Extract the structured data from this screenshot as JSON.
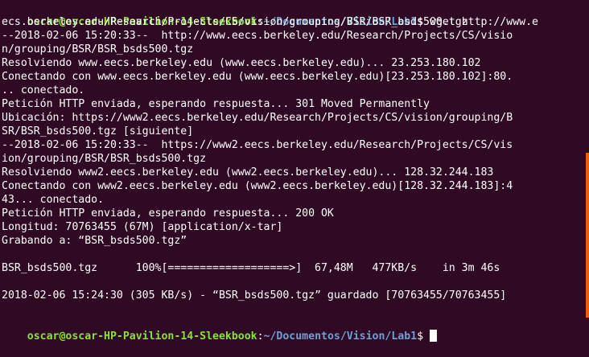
{
  "prompt": {
    "user_host": "oscar@oscar-HP-Pavilion-14-Sleekbook",
    "sep": ":",
    "path": "~/Documentos/Vision/Lab1",
    "symbol": "$ "
  },
  "command": "wget http://www.e",
  "output": [
    "ecs.berkeley.edu/Research/Projects/CS/vision/grouping/BSR/BSR_bsds500.tgz",
    "--2018-02-06 15:20:33--  http://www.eecs.berkeley.edu/Research/Projects/CS/visio",
    "n/grouping/BSR/BSR_bsds500.tgz",
    "Resolviendo www.eecs.berkeley.edu (www.eecs.berkeley.edu)... 23.253.180.102",
    "Conectando con www.eecs.berkeley.edu (www.eecs.berkeley.edu)[23.253.180.102]:80.",
    ".. conectado.",
    "Petición HTTP enviada, esperando respuesta... 301 Moved Permanently",
    "Ubicación: https://www2.eecs.berkeley.edu/Research/Projects/CS/vision/grouping/B",
    "SR/BSR_bsds500.tgz [siguiente]",
    "--2018-02-06 15:20:33--  https://www2.eecs.berkeley.edu/Research/Projects/CS/vis",
    "ion/grouping/BSR/BSR_bsds500.tgz",
    "Resolviendo www2.eecs.berkeley.edu (www2.eecs.berkeley.edu)... 128.32.244.183",
    "Conectando con www2.eecs.berkeley.edu (www2.eecs.berkeley.edu)[128.32.244.183]:4",
    "43... conectado.",
    "Petición HTTP enviada, esperando respuesta... 200 OK",
    "Longitud: 70763455 (67M) [application/x-tar]",
    "Grabando a: “BSR_bsds500.tgz”",
    "",
    "BSR_bsds500.tgz      100%[===================>]  67,48M   477KB/s    in 3m 46s",
    "",
    "2018-02-06 15:24:30 (305 KB/s) - “BSR_bsds500.tgz” guardado [70763455/70763455]",
    ""
  ],
  "colors": {
    "background": "#300a24",
    "text": "#ffffff",
    "user_host": "#8ae234",
    "path": "#729fcf",
    "edge_marker": "#e8600c"
  }
}
